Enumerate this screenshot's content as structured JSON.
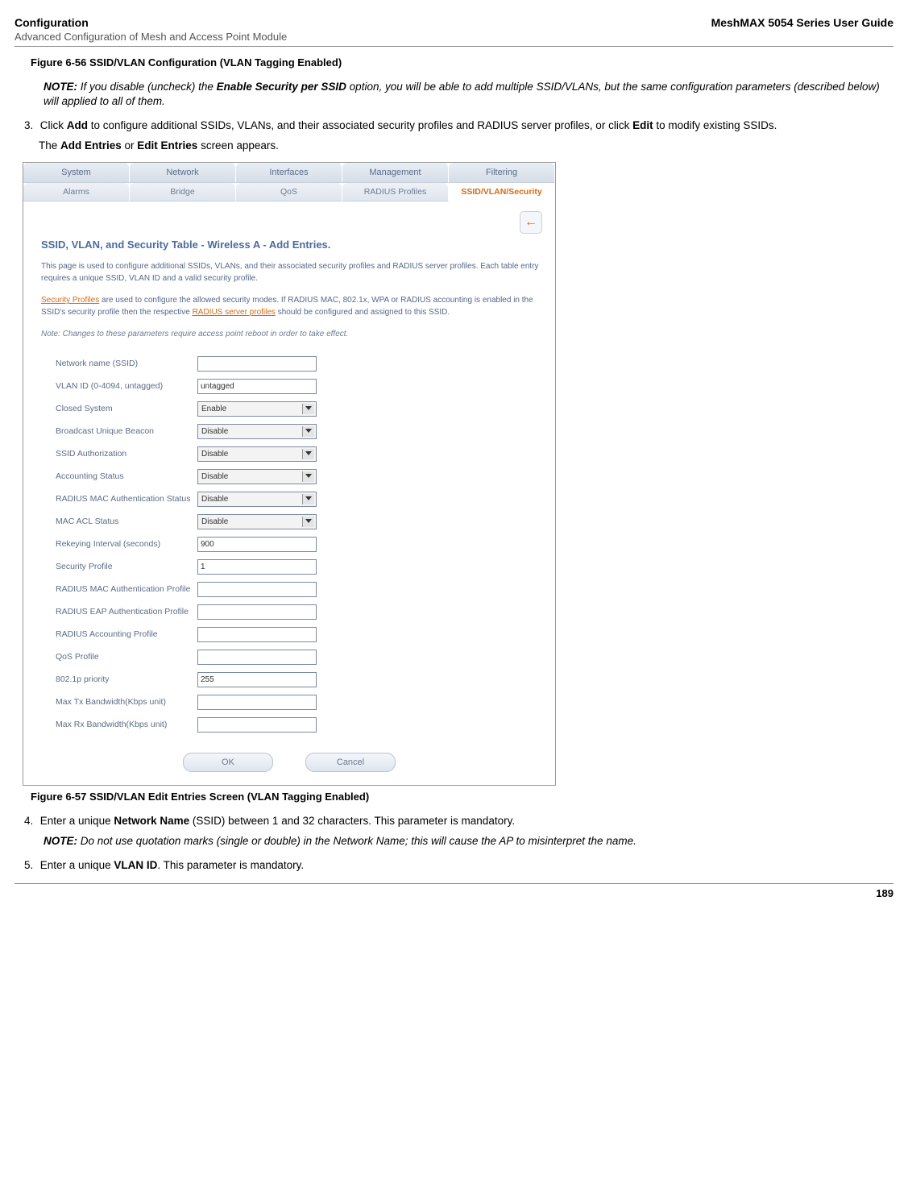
{
  "header": {
    "left_title": "Configuration",
    "right_title": "MeshMAX 5054 Series User Guide",
    "sub_title": "Advanced Configuration of Mesh and Access Point Module"
  },
  "figure_top_caption": "Figure 6-56 SSID/VLAN Configuration (VLAN Tagging Enabled)",
  "note1": {
    "label": "NOTE:",
    "text_prefix": "If you disable (uncheck) the ",
    "bold_part": "Enable Security per SSID",
    "text_suffix": " option, you will be able to add multiple SSID/VLANs, but the same configuration parameters (described below) will applied to all of them."
  },
  "step3": {
    "num": "3.",
    "pre": "Click ",
    "b1": "Add",
    "mid1": " to configure additional SSIDs, VLANs, and their associated security profiles and RADIUS server profiles, or click ",
    "b2": "Edit",
    "mid2": " to modify existing SSIDs.",
    "line2_pre": "The ",
    "line2_b1": "Add Entries",
    "line2_mid": " or ",
    "line2_b2": "Edit Entries",
    "line2_post": " screen appears."
  },
  "app": {
    "tabs1": [
      "System",
      "Network",
      "Interfaces",
      "Management",
      "Filtering"
    ],
    "tabs2": [
      "Alarms",
      "Bridge",
      "QoS",
      "RADIUS Profiles",
      "SSID/VLAN/Security"
    ],
    "back_arrow": "←",
    "title": "SSID, VLAN, and Security Table - Wireless A - Add Entries.",
    "para1": "This page is used to configure additional SSIDs, VLANs, and their associated security profiles and RADIUS server profiles. Each table entry requires a unique SSID, VLAN ID and a valid security profile.",
    "para2_link1": "Security Profiles",
    "para2_mid": " are used to configure the allowed security modes. If RADIUS MAC, 802.1x, WPA or RADIUS accounting is enabled in the SSID's security profile then the respective ",
    "para2_link2": "RADIUS server profiles",
    "para2_end": " should be configured and assigned to this SSID.",
    "para3": "Note: Changes to these parameters require access point reboot in order to take effect.",
    "fields": [
      {
        "label": "Network name (SSID)",
        "type": "input",
        "value": ""
      },
      {
        "label": "VLAN ID (0-4094, untagged)",
        "type": "input",
        "value": "untagged"
      },
      {
        "label": "Closed System",
        "type": "select",
        "value": "Enable"
      },
      {
        "label": "Broadcast Unique Beacon",
        "type": "select",
        "value": "Disable"
      },
      {
        "label": "SSID Authorization",
        "type": "select",
        "value": "Disable"
      },
      {
        "label": "Accounting Status",
        "type": "select",
        "value": "Disable"
      },
      {
        "label": "RADIUS MAC Authentication Status",
        "type": "select",
        "value": "Disable"
      },
      {
        "label": "MAC ACL Status",
        "type": "select",
        "value": "Disable"
      },
      {
        "label": "Rekeying Interval (seconds)",
        "type": "input",
        "value": "900"
      },
      {
        "label": "Security Profile",
        "type": "input",
        "value": "1"
      },
      {
        "label": "RADIUS MAC Authentication Profile",
        "type": "input",
        "value": ""
      },
      {
        "label": "RADIUS EAP Authentication Profile",
        "type": "input",
        "value": ""
      },
      {
        "label": "RADIUS Accounting Profile",
        "type": "input",
        "value": ""
      },
      {
        "label": "QoS Profile",
        "type": "input",
        "value": ""
      },
      {
        "label": "802.1p priority",
        "type": "input",
        "value": "255"
      },
      {
        "label": "Max Tx Bandwidth(Kbps unit)",
        "type": "input",
        "value": ""
      },
      {
        "label": "Max Rx Bandwidth(Kbps unit)",
        "type": "input",
        "value": ""
      }
    ],
    "buttons": {
      "ok": "OK",
      "cancel": "Cancel"
    }
  },
  "figure_bottom_caption": "Figure 6-57 SSID/VLAN Edit Entries Screen (VLAN Tagging Enabled)",
  "step4": {
    "num": "4.",
    "pre": "Enter a unique ",
    "b1": "Network Name",
    "post": " (SSID) between 1 and 32 characters. This parameter is mandatory."
  },
  "note2": {
    "label": "NOTE:",
    "text": "Do not use quotation marks (single or double) in the Network Name; this will cause the AP to misinterpret the name."
  },
  "step5": {
    "num": "5.",
    "pre": "Enter a unique ",
    "b1": "VLAN ID",
    "post": ". This parameter is mandatory."
  },
  "page_number": "189"
}
